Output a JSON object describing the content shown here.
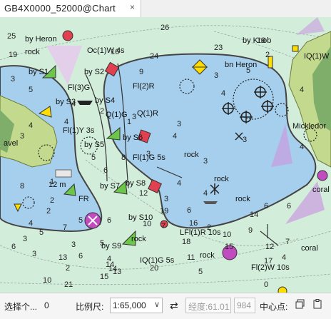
{
  "tab": {
    "title": "GB4X0000_52000@Chart",
    "close": "×"
  },
  "status_bar": {
    "select_label": "选择个...",
    "select_count": "0",
    "scale_label": "比例尺:",
    "scale_value": "1:65,000",
    "swap_icon": "⇄",
    "longitude_label": "经度:61.01",
    "latitude_value": "984",
    "center_label": "中心点:"
  },
  "map": {
    "depths": [
      {
        "v": "26"
      },
      {
        "v": "25"
      },
      {
        "v": "19"
      },
      {
        "v": "16"
      },
      {
        "v": "24"
      },
      {
        "v": "23"
      },
      {
        "v": "19"
      },
      {
        "v": "9"
      },
      {
        "v": "5"
      },
      {
        "v": "2"
      },
      {
        "v": "3"
      },
      {
        "v": "4"
      },
      {
        "v": "4"
      },
      {
        "v": "2"
      },
      {
        "v": "3"
      },
      {
        "v": "5"
      },
      {
        "v": "3"
      },
      {
        "v": "4"
      },
      {
        "v": "3"
      },
      {
        "v": "5"
      },
      {
        "v": "3"
      },
      {
        "v": "3"
      },
      {
        "v": "4"
      },
      {
        "v": "3"
      },
      {
        "v": "3"
      },
      {
        "v": "4"
      },
      {
        "v": "4"
      },
      {
        "v": "4"
      },
      {
        "v": "2"
      },
      {
        "v": "1"
      },
      {
        "v": "5"
      },
      {
        "v": "6"
      },
      {
        "v": "4"
      },
      {
        "v": "7"
      },
      {
        "v": "4"
      },
      {
        "v": "6"
      },
      {
        "v": "3"
      },
      {
        "v": "3"
      },
      {
        "v": "2"
      },
      {
        "v": "6"
      },
      {
        "v": "5"
      },
      {
        "v": "4"
      },
      {
        "v": "3"
      },
      {
        "v": "5"
      },
      {
        "v": "2"
      },
      {
        "v": "6"
      },
      {
        "v": "9"
      },
      {
        "v": "6"
      },
      {
        "v": "10"
      },
      {
        "v": "14"
      },
      {
        "v": "8"
      },
      {
        "v": "7"
      },
      {
        "v": "6"
      },
      {
        "v": "4"
      },
      {
        "v": "4"
      },
      {
        "v": "13"
      },
      {
        "v": "14"
      },
      {
        "v": "20"
      },
      {
        "v": "15"
      },
      {
        "v": "21"
      },
      {
        "v": "13"
      },
      {
        "v": "12"
      },
      {
        "v": "17"
      },
      {
        "v": "16"
      },
      {
        "v": "15"
      },
      {
        "v": "10"
      },
      {
        "v": "12"
      },
      {
        "v": "11"
      },
      {
        "v": "10"
      },
      {
        "v": "14"
      },
      {
        "v": "19"
      },
      {
        "v": "18"
      },
      {
        "v": "8"
      },
      {
        "v": "7"
      },
      {
        "v": "5"
      },
      {
        "v": "1"
      },
      {
        "v": "2"
      },
      {
        "v": "3"
      },
      {
        "v": "6"
      },
      {
        "v": "0"
      }
    ],
    "labels": [
      {
        "t": "by Heron"
      },
      {
        "t": "rock"
      },
      {
        "t": "Oc(1)W 4s"
      },
      {
        "t": "by Knob"
      },
      {
        "t": "IQ(1)W"
      },
      {
        "t": "by S1"
      },
      {
        "t": "by S2"
      },
      {
        "t": "bn Heron"
      },
      {
        "t": "Fl(3)G"
      },
      {
        "t": "Fl(2)R"
      },
      {
        "t": "by S3"
      },
      {
        "t": "by S4"
      },
      {
        "t": "Q(1)G"
      },
      {
        "t": "Q(1)R"
      },
      {
        "t": "Fl(1)Y 3s"
      },
      {
        "t": "by S6"
      },
      {
        "t": "by S5"
      },
      {
        "t": "Mickledor"
      },
      {
        "t": "avel"
      },
      {
        "t": "Fl(1)G 5s"
      },
      {
        "t": "rock"
      },
      {
        "t": "12 m"
      },
      {
        "t": "by S7"
      },
      {
        "t": "by S8"
      },
      {
        "t": "FR"
      },
      {
        "t": "rock"
      },
      {
        "t": "by S10"
      },
      {
        "t": "LFl(1)R 10s"
      },
      {
        "t": "coral"
      },
      {
        "t": "by S9"
      },
      {
        "t": "rock"
      },
      {
        "t": "rock"
      },
      {
        "t": "IQ(1)G 5s"
      },
      {
        "t": "Fl(2)W 10s"
      },
      {
        "t": "coral"
      },
      {
        "t": "rock"
      }
    ]
  }
}
